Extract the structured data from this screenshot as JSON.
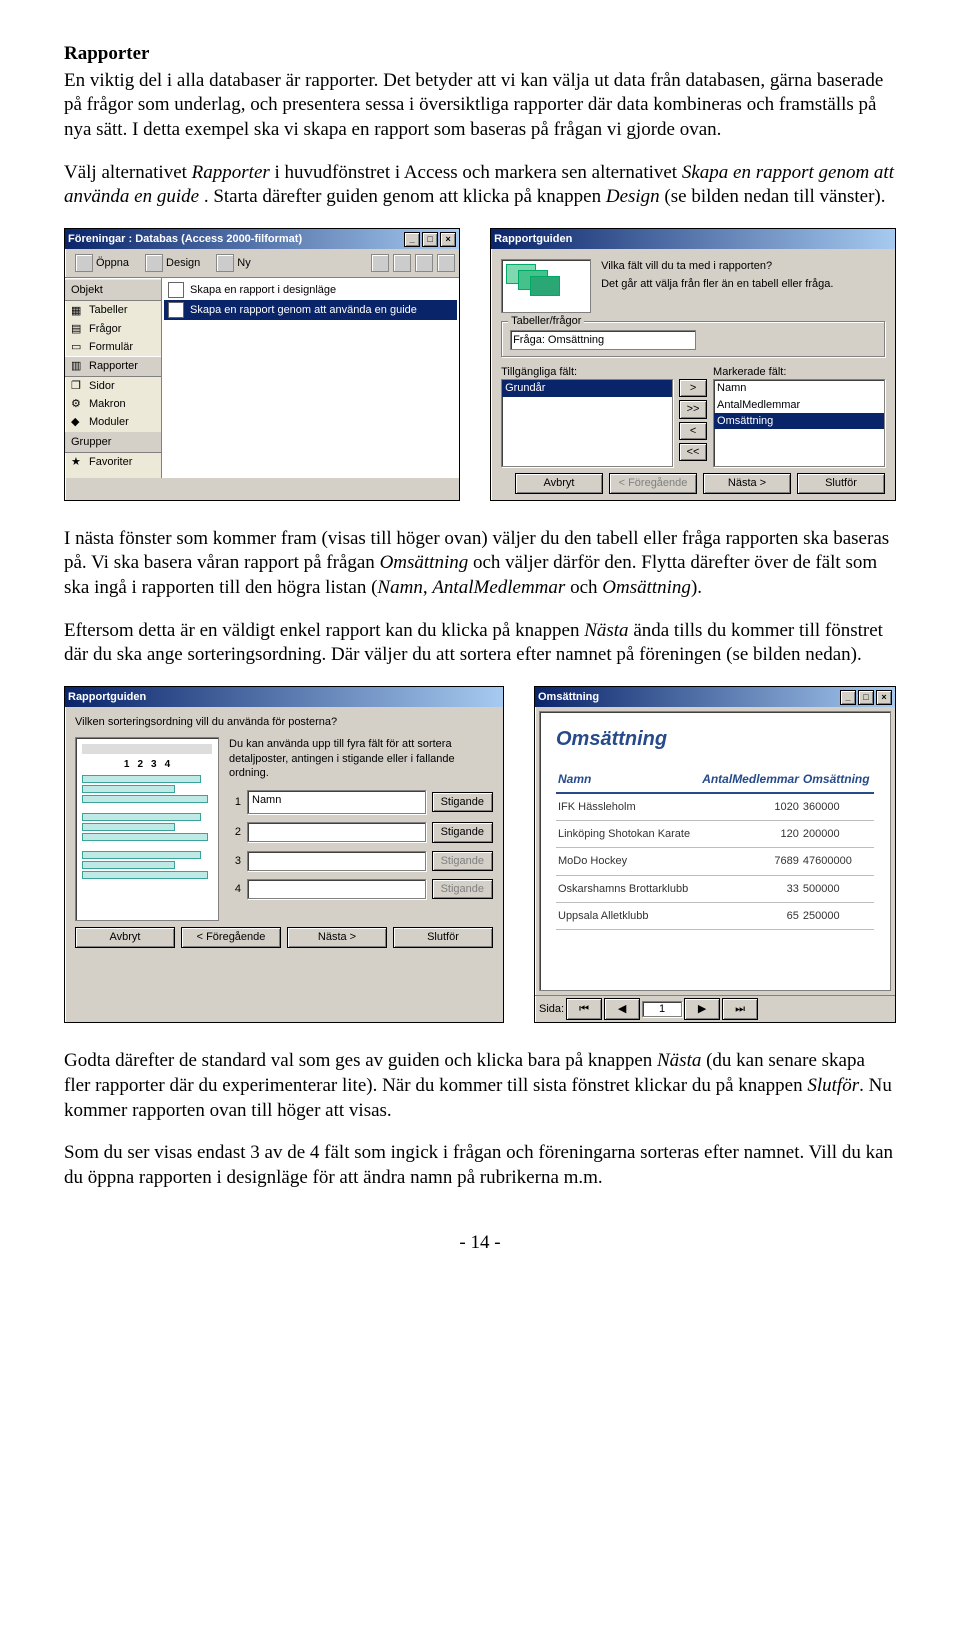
{
  "heading": "Rapporter",
  "para1": "En viktig del i alla databaser är rapporter. Det betyder att vi kan välja ut data från databasen, gärna baserade på frågor som underlag, och presentera sessa i översiktliga rapporter där data kombineras och framställs på nya sätt. I detta exempel ska vi skapa en rapport som baseras på frågan vi gjorde ovan.",
  "para2_pre": "Välj alternativet ",
  "para2_i1": "Rapporter",
  "para2_mid1": " i huvudfönstret i Access och markera sen alternativet ",
  "para2_i2": "Skapa en rapport genom att använda en guide",
  "para2_mid2": ". Starta därefter guiden genom att klicka på knappen ",
  "para2_i3": "Design",
  "para2_end": " (se bilden nedan till vänster).",
  "fig1": {
    "title": "Föreningar : Databas (Access 2000-filformat)",
    "toolbar": {
      "open": "Öppna",
      "design": "Design",
      "new": "Ny"
    },
    "sideHeader": "Objekt",
    "sideItems": [
      "Tabeller",
      "Frågor",
      "Formulär",
      "Rapporter",
      "Sidor",
      "Makron",
      "Moduler"
    ],
    "sideGroup": "Grupper",
    "sideFav": "Favoriter",
    "mainRows": [
      "Skapa en rapport i designläge",
      "Skapa en rapport genom att använda en guide"
    ]
  },
  "fig2": {
    "title": "Rapportguiden",
    "q1": "Vilka fält vill du ta med i rapporten?",
    "q2": "Det går att välja från fler än en tabell eller fråga.",
    "groupLabel": "Tabeller/frågor",
    "queryLabel": "Fråga: Omsättning",
    "availLabel": "Tillgängliga fält:",
    "selLabel": "Markerade fält:",
    "available": [
      "Grundår"
    ],
    "selected": [
      "Namn",
      "AntalMedlemmar",
      "Omsättning"
    ],
    "btns": {
      "cancel": "Avbryt",
      "prev": "< Föregående",
      "next": "Nästa >",
      "finish": "Slutför"
    }
  },
  "para3_a": "I nästa fönster som kommer fram (visas till höger ovan) väljer du den tabell eller fråga rapporten ska baseras på. Vi ska basera våran rapport på frågan ",
  "para3_i1": "Omsättning",
  "para3_b": " och väljer därför den. Flytta därefter över de fält som ska ingå i rapporten till den högra listan (",
  "para3_i2": "Namn",
  "para3_c": ", ",
  "para3_i3": "AntalMedlemmar",
  "para3_d": " och ",
  "para3_i4": "Omsättning",
  "para3_e": ").",
  "para4_a": "Eftersom detta är en väldigt enkel rapport kan du klicka på knappen ",
  "para4_i1": "Nästa",
  "para4_b": " ända tills du kommer till fönstret där du ska ange sorteringsordning. Där väljer du att sortera efter namnet på föreningen (se bilden nedan).",
  "fig3": {
    "title": "Rapportguiden",
    "prompt": "Vilken sorteringsordning vill du använda för posterna?",
    "hint": "Du kan använda upp till fyra fält för att sortera detaljposter, antingen i stigande eller i fallande ordning.",
    "rows": [
      {
        "n": "1",
        "val": "Namn",
        "btn": "Stigande",
        "enabled": true
      },
      {
        "n": "2",
        "val": "",
        "btn": "Stigande",
        "enabled": true
      },
      {
        "n": "3",
        "val": "",
        "btn": "Stigande",
        "enabled": false
      },
      {
        "n": "4",
        "val": "",
        "btn": "Stigande",
        "enabled": false
      }
    ],
    "btns": {
      "cancel": "Avbryt",
      "prev": "< Föregående",
      "next": "Nästa >",
      "finish": "Slutför"
    }
  },
  "fig4": {
    "title": "Omsättning",
    "reportTitle": "Omsättning",
    "cols": [
      "Namn",
      "AntalMedlemmar",
      "Omsättning"
    ],
    "rows": [
      [
        "IFK Hässleholm",
        "1020",
        "360000"
      ],
      [
        "Linköping Shotokan Karate",
        "120",
        "200000"
      ],
      [
        "MoDo Hockey",
        "7689",
        "47600000"
      ],
      [
        "Oskarshamns Brottarklubb",
        "33",
        "500000"
      ],
      [
        "Uppsala Alletklubb",
        "65",
        "250000"
      ]
    ],
    "navLabel": "Sida:",
    "page": "1"
  },
  "para5_a": "Godta därefter de standard val som ges av guiden och klicka bara på knappen ",
  "para5_i1": "Nästa",
  "para5_b": " (du kan senare skapa fler rapporter där du experimenterar lite). När du kommer till sista fönstret klickar du på knappen ",
  "para5_i2": "Slutför",
  "para5_c": ". Nu kommer rapporten ovan till höger att visas.",
  "para6": "Som du ser visas endast 3 av de 4 fält som ingick i frågan och föreningarna sorteras efter namnet. Vill du kan du öppna rapporten i designläge för att ändra namn på rubrikerna m.m.",
  "footer": "- 14 -"
}
